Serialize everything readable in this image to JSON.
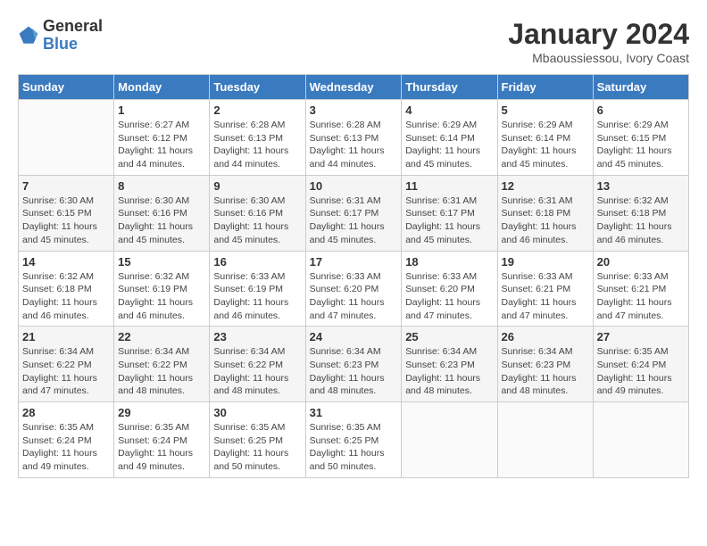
{
  "logo": {
    "text_general": "General",
    "text_blue": "Blue"
  },
  "title": "January 2024",
  "subtitle": "Mbaoussiessou, Ivory Coast",
  "days_of_week": [
    "Sunday",
    "Monday",
    "Tuesday",
    "Wednesday",
    "Thursday",
    "Friday",
    "Saturday"
  ],
  "weeks": [
    [
      {
        "day": "",
        "detail": ""
      },
      {
        "day": "1",
        "detail": "Sunrise: 6:27 AM\nSunset: 6:12 PM\nDaylight: 11 hours\nand 44 minutes."
      },
      {
        "day": "2",
        "detail": "Sunrise: 6:28 AM\nSunset: 6:13 PM\nDaylight: 11 hours\nand 44 minutes."
      },
      {
        "day": "3",
        "detail": "Sunrise: 6:28 AM\nSunset: 6:13 PM\nDaylight: 11 hours\nand 44 minutes."
      },
      {
        "day": "4",
        "detail": "Sunrise: 6:29 AM\nSunset: 6:14 PM\nDaylight: 11 hours\nand 45 minutes."
      },
      {
        "day": "5",
        "detail": "Sunrise: 6:29 AM\nSunset: 6:14 PM\nDaylight: 11 hours\nand 45 minutes."
      },
      {
        "day": "6",
        "detail": "Sunrise: 6:29 AM\nSunset: 6:15 PM\nDaylight: 11 hours\nand 45 minutes."
      }
    ],
    [
      {
        "day": "7",
        "detail": "Sunrise: 6:30 AM\nSunset: 6:15 PM\nDaylight: 11 hours\nand 45 minutes."
      },
      {
        "day": "8",
        "detail": "Sunrise: 6:30 AM\nSunset: 6:16 PM\nDaylight: 11 hours\nand 45 minutes."
      },
      {
        "day": "9",
        "detail": "Sunrise: 6:30 AM\nSunset: 6:16 PM\nDaylight: 11 hours\nand 45 minutes."
      },
      {
        "day": "10",
        "detail": "Sunrise: 6:31 AM\nSunset: 6:17 PM\nDaylight: 11 hours\nand 45 minutes."
      },
      {
        "day": "11",
        "detail": "Sunrise: 6:31 AM\nSunset: 6:17 PM\nDaylight: 11 hours\nand 45 minutes."
      },
      {
        "day": "12",
        "detail": "Sunrise: 6:31 AM\nSunset: 6:18 PM\nDaylight: 11 hours\nand 46 minutes."
      },
      {
        "day": "13",
        "detail": "Sunrise: 6:32 AM\nSunset: 6:18 PM\nDaylight: 11 hours\nand 46 minutes."
      }
    ],
    [
      {
        "day": "14",
        "detail": "Sunrise: 6:32 AM\nSunset: 6:18 PM\nDaylight: 11 hours\nand 46 minutes."
      },
      {
        "day": "15",
        "detail": "Sunrise: 6:32 AM\nSunset: 6:19 PM\nDaylight: 11 hours\nand 46 minutes."
      },
      {
        "day": "16",
        "detail": "Sunrise: 6:33 AM\nSunset: 6:19 PM\nDaylight: 11 hours\nand 46 minutes."
      },
      {
        "day": "17",
        "detail": "Sunrise: 6:33 AM\nSunset: 6:20 PM\nDaylight: 11 hours\nand 47 minutes."
      },
      {
        "day": "18",
        "detail": "Sunrise: 6:33 AM\nSunset: 6:20 PM\nDaylight: 11 hours\nand 47 minutes."
      },
      {
        "day": "19",
        "detail": "Sunrise: 6:33 AM\nSunset: 6:21 PM\nDaylight: 11 hours\nand 47 minutes."
      },
      {
        "day": "20",
        "detail": "Sunrise: 6:33 AM\nSunset: 6:21 PM\nDaylight: 11 hours\nand 47 minutes."
      }
    ],
    [
      {
        "day": "21",
        "detail": "Sunrise: 6:34 AM\nSunset: 6:22 PM\nDaylight: 11 hours\nand 47 minutes."
      },
      {
        "day": "22",
        "detail": "Sunrise: 6:34 AM\nSunset: 6:22 PM\nDaylight: 11 hours\nand 48 minutes."
      },
      {
        "day": "23",
        "detail": "Sunrise: 6:34 AM\nSunset: 6:22 PM\nDaylight: 11 hours\nand 48 minutes."
      },
      {
        "day": "24",
        "detail": "Sunrise: 6:34 AM\nSunset: 6:23 PM\nDaylight: 11 hours\nand 48 minutes."
      },
      {
        "day": "25",
        "detail": "Sunrise: 6:34 AM\nSunset: 6:23 PM\nDaylight: 11 hours\nand 48 minutes."
      },
      {
        "day": "26",
        "detail": "Sunrise: 6:34 AM\nSunset: 6:23 PM\nDaylight: 11 hours\nand 48 minutes."
      },
      {
        "day": "27",
        "detail": "Sunrise: 6:35 AM\nSunset: 6:24 PM\nDaylight: 11 hours\nand 49 minutes."
      }
    ],
    [
      {
        "day": "28",
        "detail": "Sunrise: 6:35 AM\nSunset: 6:24 PM\nDaylight: 11 hours\nand 49 minutes."
      },
      {
        "day": "29",
        "detail": "Sunrise: 6:35 AM\nSunset: 6:24 PM\nDaylight: 11 hours\nand 49 minutes."
      },
      {
        "day": "30",
        "detail": "Sunrise: 6:35 AM\nSunset: 6:25 PM\nDaylight: 11 hours\nand 50 minutes."
      },
      {
        "day": "31",
        "detail": "Sunrise: 6:35 AM\nSunset: 6:25 PM\nDaylight: 11 hours\nand 50 minutes."
      },
      {
        "day": "",
        "detail": ""
      },
      {
        "day": "",
        "detail": ""
      },
      {
        "day": "",
        "detail": ""
      }
    ]
  ]
}
